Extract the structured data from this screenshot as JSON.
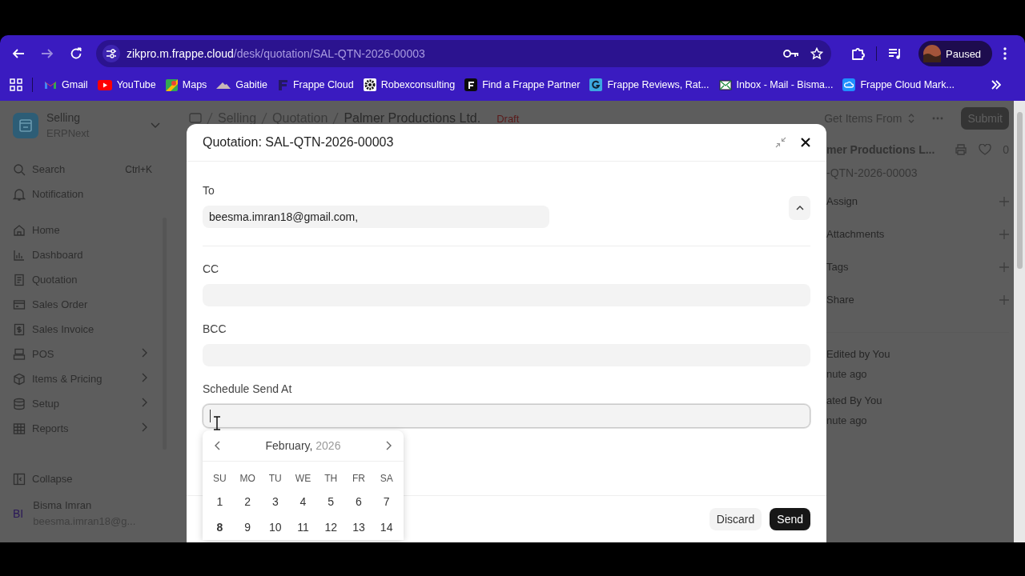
{
  "browser": {
    "url_host": "zikpro.m.frappe.cloud",
    "url_path": "/desk/quotation/SAL-QTN-2026-00003",
    "profile": "Paused",
    "bookmarks": [
      {
        "label": "Gmail",
        "kind": "gmail"
      },
      {
        "label": "YouTube",
        "kind": "youtube"
      },
      {
        "label": "Maps",
        "kind": "maps"
      },
      {
        "label": "Gabitie",
        "kind": "mountain"
      },
      {
        "label": "Frappe Cloud",
        "kind": "frappe"
      },
      {
        "label": "Robexconsulting",
        "kind": "gear"
      },
      {
        "label": "Find a Frappe Partner",
        "kind": "frappe_box"
      },
      {
        "label": "Frappe Reviews, Rat...",
        "kind": "g"
      },
      {
        "label": "Inbox - Mail - Bisma...",
        "kind": "mail"
      },
      {
        "label": "Frappe Cloud Mark...",
        "kind": "cloud"
      }
    ]
  },
  "sidebar": {
    "app": "Selling",
    "subtitle": "ERPNext",
    "search": "Search",
    "shortcut": "Ctrl+K",
    "notification": "Notification",
    "items": [
      {
        "label": "Home",
        "kind": "home",
        "has_children": false
      },
      {
        "label": "Dashboard",
        "kind": "chart",
        "has_children": false
      },
      {
        "label": "Quotation",
        "kind": "doc",
        "has_children": false
      },
      {
        "label": "Sales Order",
        "kind": "card",
        "has_children": false
      },
      {
        "label": "Sales Invoice",
        "kind": "dollar",
        "has_children": false
      },
      {
        "label": "POS",
        "kind": "pos",
        "has_children": true
      },
      {
        "label": "Items & Pricing",
        "kind": "box",
        "has_children": true
      },
      {
        "label": "Setup",
        "kind": "db",
        "has_children": true
      },
      {
        "label": "Reports",
        "kind": "table",
        "has_children": true
      }
    ],
    "collapse": "Collapse",
    "user": {
      "initials": "BI",
      "name": "Bisma Imran",
      "email": "beesma.imran18@g..."
    }
  },
  "page": {
    "breadcrumbs": [
      "Selling",
      "Quotation",
      "Palmer Productions Ltd."
    ],
    "status": "Draft",
    "get_items": "Get Items From",
    "submit": "Submit"
  },
  "side_panel": {
    "title": "mer Productions L...",
    "name": "-QTN-2026-00003",
    "likes": "0",
    "sections": [
      "Assign",
      "Attachments",
      "Tags",
      "Share"
    ],
    "activity": [
      {
        "text": "Edited by You",
        "time": "nute ago"
      },
      {
        "text": "ated By You",
        "time": "nute ago"
      }
    ]
  },
  "dialog": {
    "title": "Quotation: SAL-QTN-2026-00003",
    "to": {
      "label": "To",
      "value": "beesma.imran18@gmail.com,"
    },
    "cc": {
      "label": "CC"
    },
    "bcc": {
      "label": "BCC"
    },
    "schedule": {
      "label": "Schedule Send At",
      "focused": true
    },
    "calendar": {
      "month": "February,",
      "year": "2026",
      "weekdays": [
        "SU",
        "MO",
        "TU",
        "WE",
        "TH",
        "FR",
        "SA"
      ],
      "days": [
        {
          "label": "1",
          "today": false
        },
        {
          "label": "2",
          "today": false
        },
        {
          "label": "3",
          "today": false
        },
        {
          "label": "4",
          "today": false
        },
        {
          "label": "5",
          "today": false
        },
        {
          "label": "6",
          "today": false
        },
        {
          "label": "7",
          "today": false
        },
        {
          "label": "8",
          "today": true
        },
        {
          "label": "9",
          "today": false
        },
        {
          "label": "10",
          "today": false
        },
        {
          "label": "11",
          "today": false
        },
        {
          "label": "12",
          "today": false
        },
        {
          "label": "13",
          "today": false
        },
        {
          "label": "14",
          "today": false
        }
      ]
    },
    "discard": "Discard",
    "send": "Send"
  }
}
